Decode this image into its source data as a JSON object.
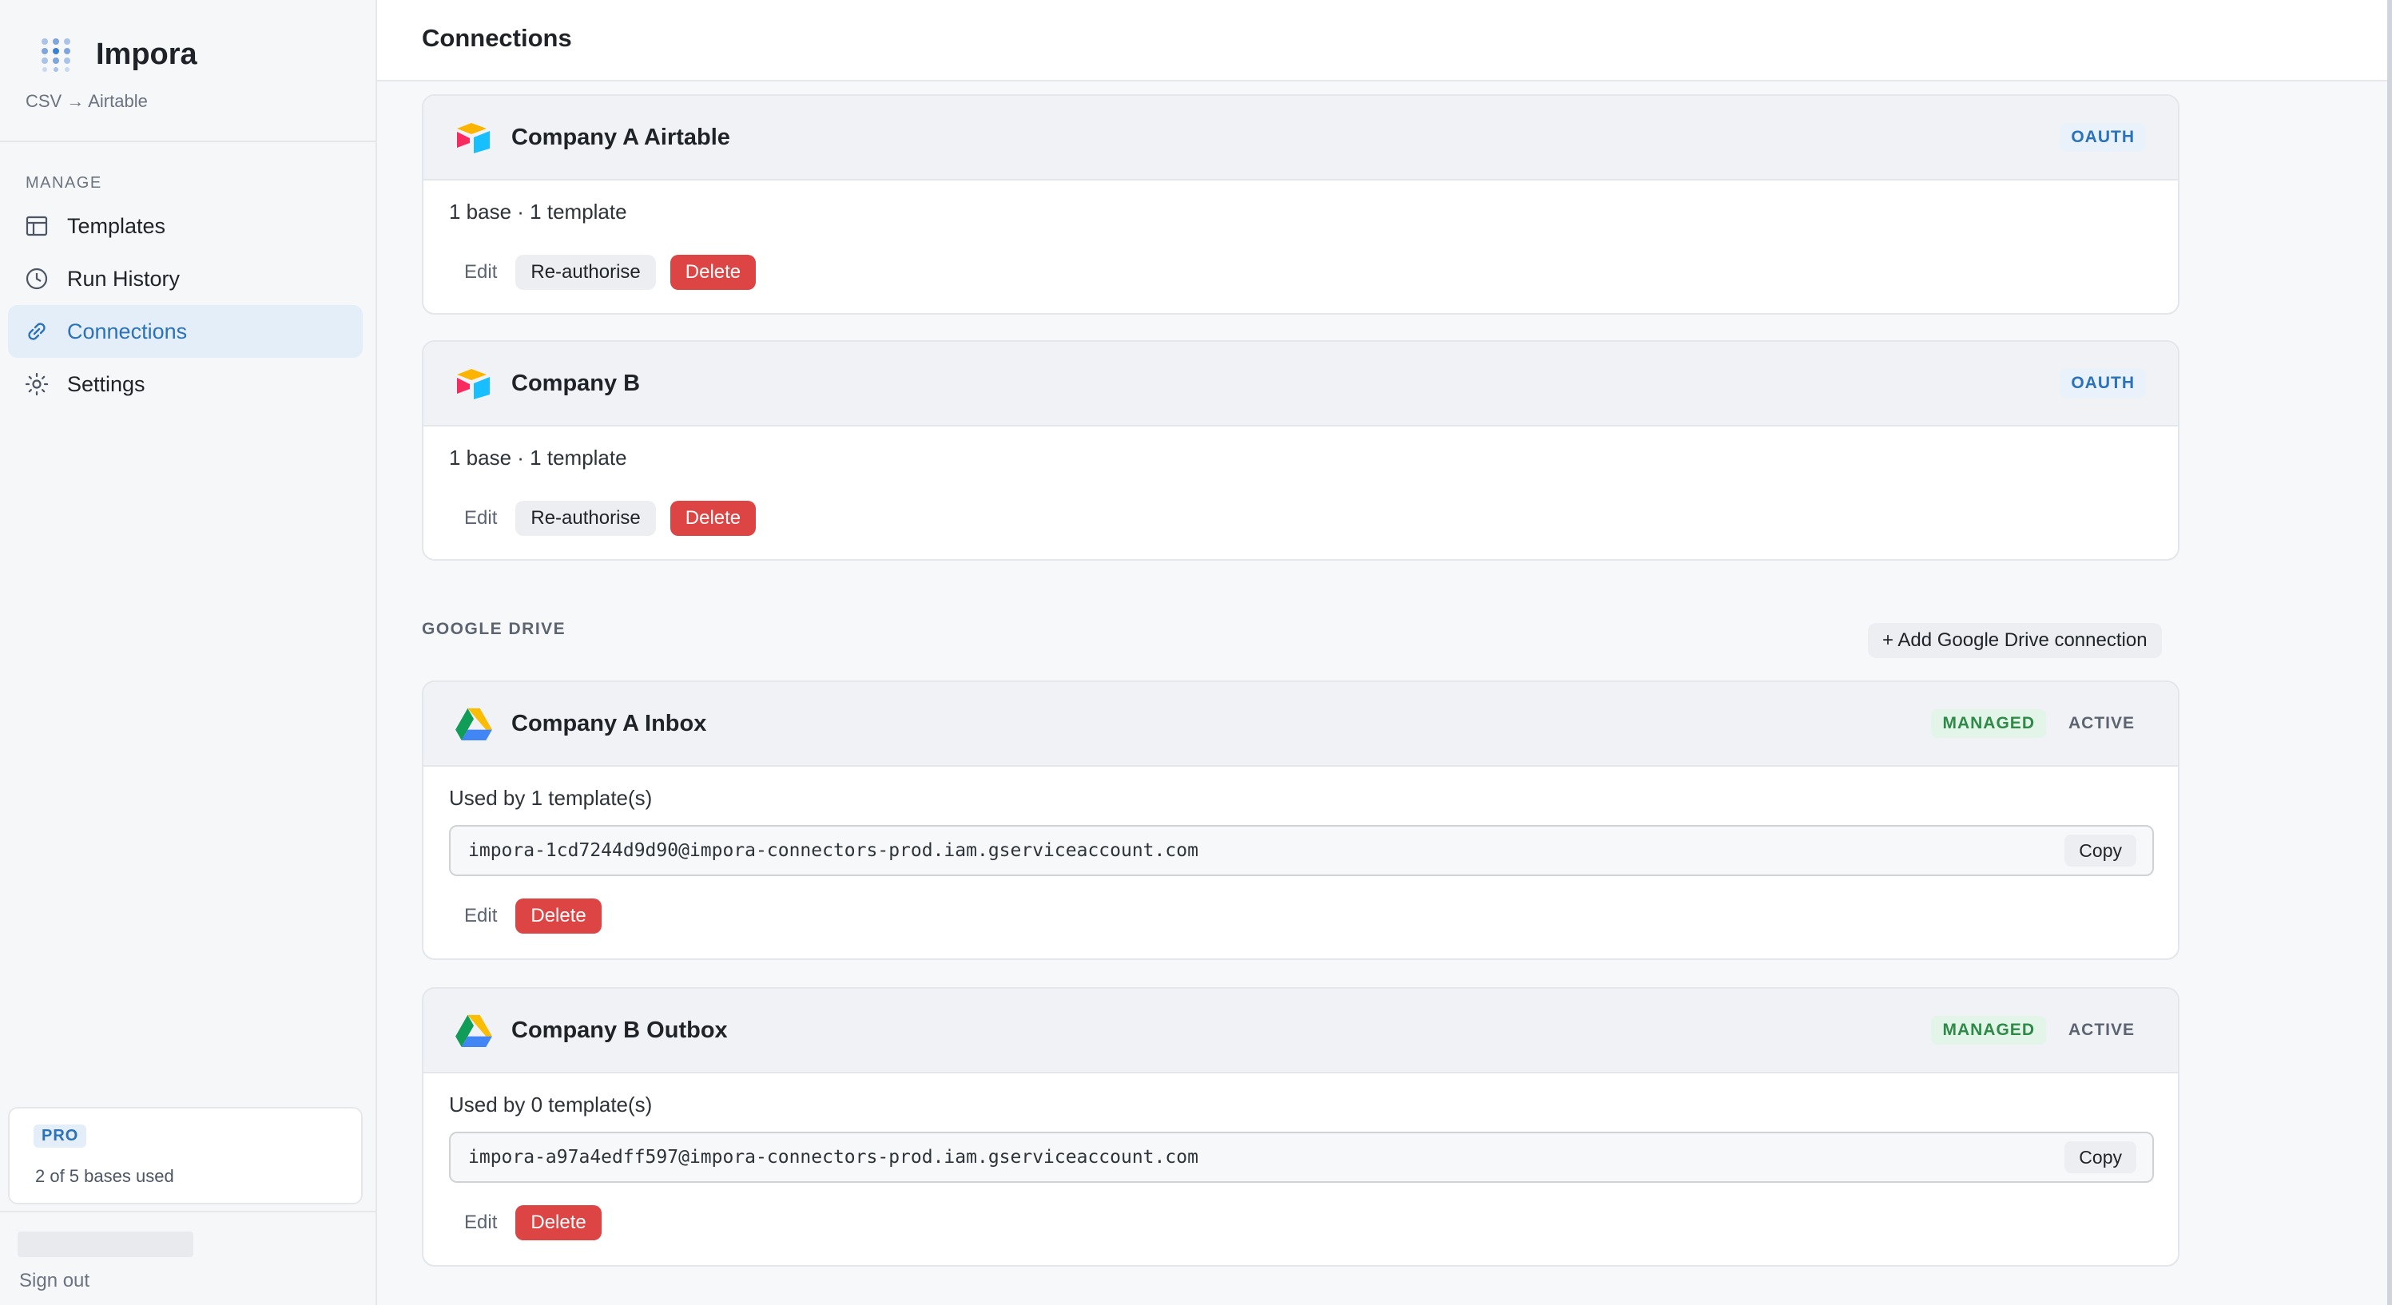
{
  "app": {
    "name": "Impora",
    "subtitle": "CSV → Airtable"
  },
  "sidebar": {
    "section_label": "MANAGE",
    "items": [
      {
        "label": "Templates",
        "icon": "table-icon",
        "active": false
      },
      {
        "label": "Run History",
        "icon": "clock-icon",
        "active": false
      },
      {
        "label": "Connections",
        "icon": "link-icon",
        "active": true
      },
      {
        "label": "Settings",
        "icon": "gear-icon",
        "active": false
      }
    ],
    "plan": {
      "badge": "PRO",
      "usage": "2 of 5 bases used"
    },
    "sign_out": "Sign out"
  },
  "header": {
    "title": "Connections"
  },
  "airtable_connections": [
    {
      "name": "Company A Airtable",
      "badge": "OAUTH",
      "meta": "1 base · 1 template",
      "edit": "Edit",
      "reauth": "Re-authorise",
      "delete": "Delete"
    },
    {
      "name": "Company B",
      "badge": "OAUTH",
      "meta": "1 base · 1 template",
      "edit": "Edit",
      "reauth": "Re-authorise",
      "delete": "Delete"
    }
  ],
  "google_drive": {
    "heading": "GOOGLE DRIVE",
    "add_button": "+ Add Google Drive connection",
    "connections": [
      {
        "name": "Company A Inbox",
        "badge_managed": "MANAGED",
        "badge_status": "ACTIVE",
        "meta": "Used by 1 template(s)",
        "email": "impora-1cd7244d9d90@impora-connectors-prod.iam.gserviceaccount.com",
        "copy": "Copy",
        "edit": "Edit",
        "delete": "Delete"
      },
      {
        "name": "Company B Outbox",
        "badge_managed": "MANAGED",
        "badge_status": "ACTIVE",
        "meta": "Used by 0 template(s)",
        "email": "impora-a97a4edff597@impora-connectors-prod.iam.gserviceaccount.com",
        "copy": "Copy",
        "edit": "Edit",
        "delete": "Delete"
      }
    ]
  },
  "colors": {
    "accent": "#2b72b8",
    "danger": "#dd4444",
    "managed": "#2f8a4a"
  }
}
